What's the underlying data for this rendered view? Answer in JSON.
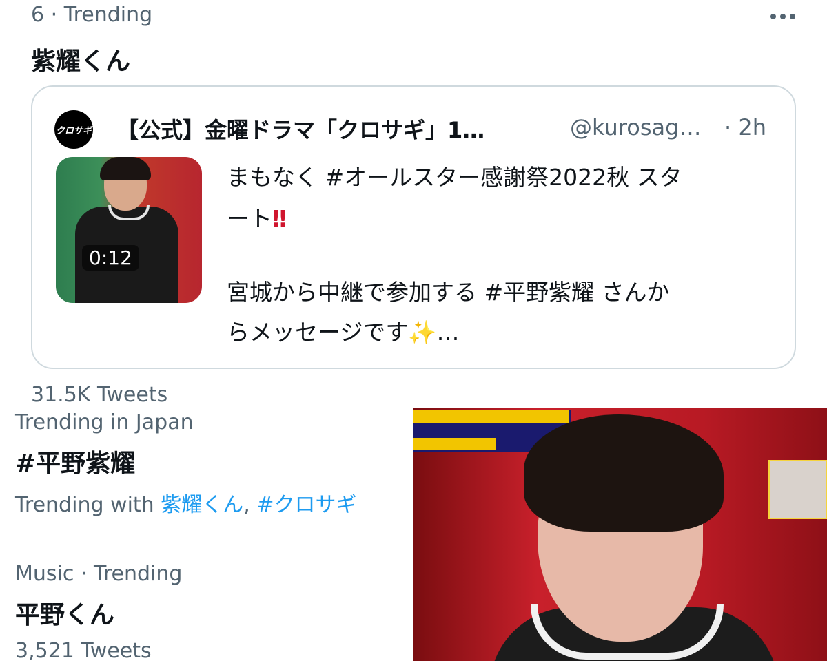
{
  "trend1": {
    "meta": "6 · Trending",
    "title": "紫耀くん"
  },
  "tweet": {
    "avatar_text": "クロサギ",
    "author": "【公式】金曜ドラマ「クロサギ」1…",
    "handle": "@kurosag…",
    "time": "· 2h",
    "video_duration": "0:12",
    "line1": "まもなく #オールスター感謝祭2022秋 スタ",
    "line2_text": "ート",
    "line2_emoji": "‼",
    "line3": "宮城から中継で参加する #平野紫耀 さんか",
    "line4_text": "らメッセージです",
    "line4_emoji": "✨",
    "line4_tail": "…"
  },
  "trend1_count": "31.5K Tweets",
  "trend2": {
    "meta": "Trending in Japan",
    "title": "#平野紫耀",
    "with_label": "Trending with",
    "with_link1": "紫耀くん",
    "separator": ",",
    "with_link2": "#クロサギ"
  },
  "trend3": {
    "meta": "Music · Trending",
    "title": "平野くん",
    "count": "3,521 Tweets"
  },
  "icons": {
    "more": "more-horizontal-icon"
  }
}
